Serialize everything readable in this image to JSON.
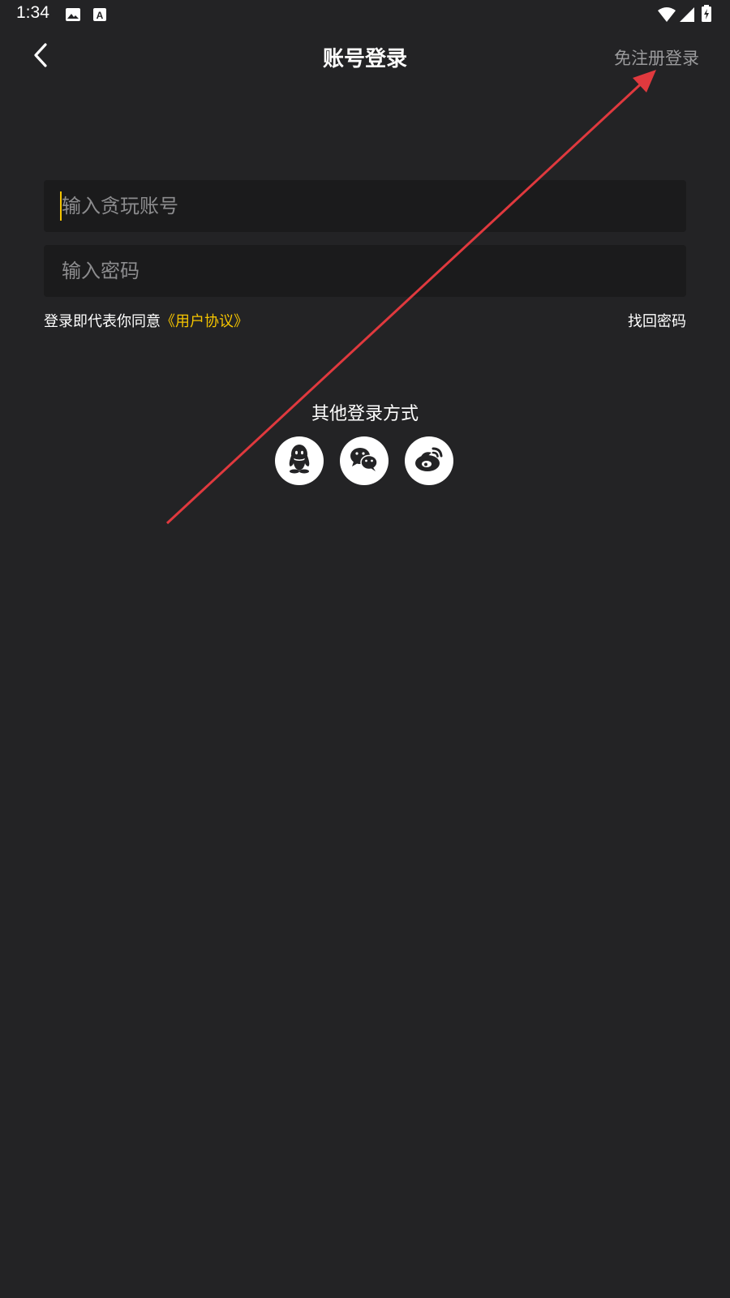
{
  "status_bar": {
    "time": "1:34",
    "icons": [
      "image-icon",
      "text-a-icon",
      "wifi-icon",
      "signal-icon",
      "battery-icon"
    ]
  },
  "header": {
    "title": "账号登录",
    "back_icon": "chevron-left-icon",
    "register_label": "免注册登录"
  },
  "form": {
    "account_placeholder": "输入贪玩账号",
    "account_value": "",
    "password_placeholder": "输入密码",
    "password_value": "",
    "agreement_prefix": "登录即代表你同意",
    "agreement_link": "《用户协议》",
    "forgot_password": "找回密码"
  },
  "other_login": {
    "title": "其他登录方式",
    "methods": [
      {
        "name": "QQ",
        "icon": "qq-icon"
      },
      {
        "name": "WeChat",
        "icon": "wechat-icon"
      },
      {
        "name": "Weibo",
        "icon": "weibo-icon"
      }
    ]
  },
  "colors": {
    "background": "#232325",
    "input_background": "#1b1b1c",
    "accent": "#f5c400",
    "muted_text": "#9a9a9c",
    "annotation_arrow": "#e0393e"
  }
}
